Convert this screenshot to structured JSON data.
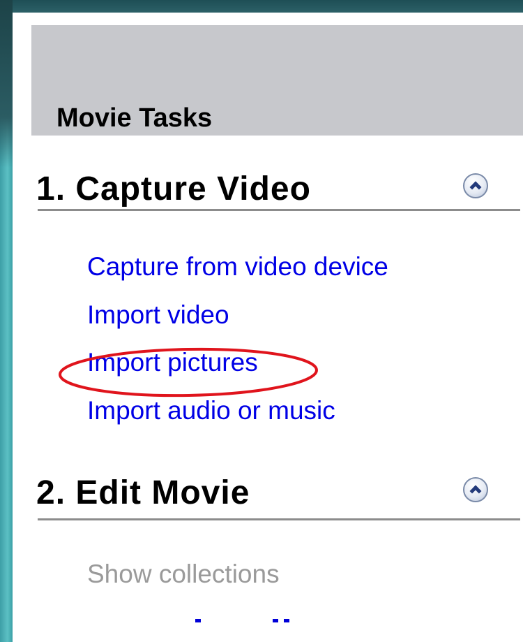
{
  "pane": {
    "title": "Movie Tasks"
  },
  "sections": [
    {
      "title": "1. Capture Video",
      "items": [
        "Capture from video device",
        "Import video",
        "Import pictures",
        "Import audio or music"
      ]
    },
    {
      "title": "2. Edit Movie",
      "items": [
        "Show collections"
      ]
    }
  ],
  "colors": {
    "link": "#0000e6",
    "disabled_link": "#9a9a9a",
    "header_bg": "#c7c8cc",
    "annotation": "#e0141c"
  },
  "icons": {
    "collapse": "chevron-up-icon"
  }
}
